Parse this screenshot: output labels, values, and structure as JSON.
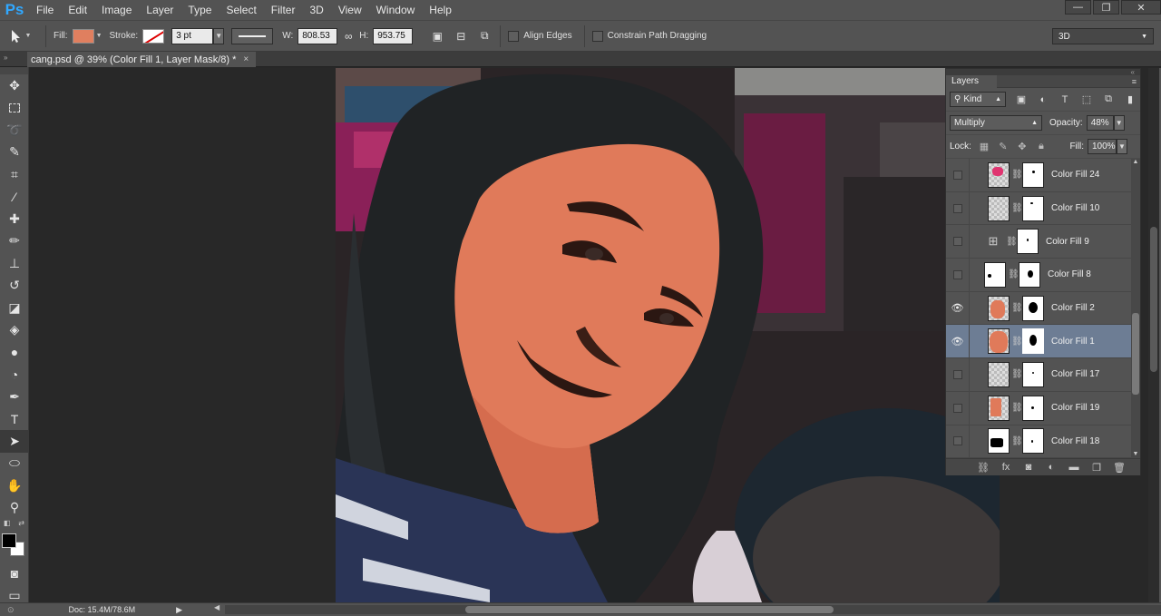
{
  "app": {
    "logo": "Ps"
  },
  "menu": [
    "File",
    "Edit",
    "Image",
    "Layer",
    "Type",
    "Select",
    "Filter",
    "3D",
    "View",
    "Window",
    "Help"
  ],
  "window_controls": {
    "minimize": "—",
    "restore": "❐",
    "close": "✕"
  },
  "options": {
    "fill_label": "Fill:",
    "stroke_label": "Stroke:",
    "stroke_width": "3 pt",
    "w_label": "W:",
    "w_value": "808.53",
    "h_label": "H:",
    "h_value": "953.75",
    "align_edges": "Align Edges",
    "constrain_path": "Constrain Path Dragging",
    "workspace": "3D",
    "fill_color": "#e07f5f"
  },
  "document": {
    "tab_title": "cang.psd @ 39% (Color Fill 1, Layer Mask/8) *",
    "tab_close": "×"
  },
  "status": {
    "doc": "Doc: 15.4M/78.6M"
  },
  "layers_panel": {
    "title": "Layers",
    "filter_kind": "Kind",
    "blend_mode": "Multiply",
    "opacity_label": "Opacity:",
    "opacity": "48%",
    "lock_label": "Lock:",
    "fill_label": "Fill:",
    "fill": "100%",
    "layers": [
      {
        "name": "Color Fill 24",
        "visible": false,
        "selected": false
      },
      {
        "name": "Color Fill 10",
        "visible": false,
        "selected": false
      },
      {
        "name": "Color Fill 9",
        "visible": false,
        "selected": false
      },
      {
        "name": "Color Fill 8",
        "visible": false,
        "selected": false
      },
      {
        "name": "Color Fill 2",
        "visible": true,
        "selected": false
      },
      {
        "name": "Color Fill 1",
        "visible": true,
        "selected": true
      },
      {
        "name": "Color Fill 17",
        "visible": false,
        "selected": false
      },
      {
        "name": "Color Fill 19",
        "visible": false,
        "selected": false
      },
      {
        "name": "Color Fill 18",
        "visible": false,
        "selected": false
      }
    ]
  }
}
